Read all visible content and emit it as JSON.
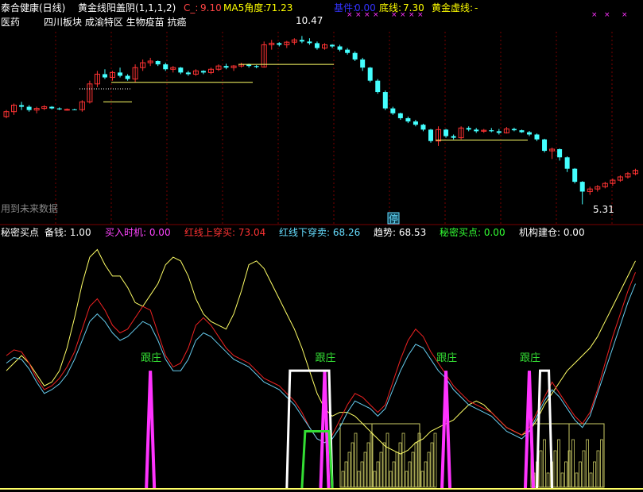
{
  "header": {
    "stock_name": "泰合健康(日线)",
    "indicator": "黄金线阳盖阴(1,1,1,2)",
    "c_label": "C_:",
    "c_value": "9.10",
    "ma5_label": "MA5角度:",
    "ma5_value": "71.23",
    "low_label": "底线:",
    "low_value": "7.30",
    "gold_label": "黄金虚线:",
    "gold_value": "-",
    "cut_label": "基件:",
    "cut_value": "0.00"
  },
  "tags": {
    "medicine": "医药",
    "concepts": "四川板块 成渝特区 生物疫苗 抗癌",
    "future": "用到未来数据",
    "stop": "停",
    "high_mark": "10.47",
    "low_mark": "5.31"
  },
  "indicator_header": {
    "name": "秘密买点",
    "items": [
      {
        "label": "备钱:",
        "value": "1.00",
        "color": "#ffffff"
      },
      {
        "label": "买入时机:",
        "value": "0.00",
        "color": "#ff44ff"
      },
      {
        "label": "红线上穿买:",
        "value": "73.04",
        "color": "#ff3333"
      },
      {
        "label": "红线下穿卖:",
        "value": "68.26",
        "color": "#66ddff"
      },
      {
        "label": "趋势:",
        "value": "68.53",
        "color": "#ffffff"
      },
      {
        "label": "秘密买点:",
        "value": "0.00",
        "color": "#33ff33"
      },
      {
        "label": "机构建仓:",
        "value": "0.00",
        "color": "#ffffff"
      }
    ],
    "follow_label": "跟庄"
  },
  "colors": {
    "up": "#ff3333",
    "down": "#44ffff",
    "yellow": "#ffff66",
    "magenta": "#ff33ff",
    "green": "#33dd33",
    "cyan_line": "#66ccee",
    "red_line": "#ee2222",
    "white": "#ffffff",
    "grid": "#7a0000"
  },
  "chart_data": {
    "type": "candlestick",
    "price": {
      "high_label": "10.47",
      "low_label": "5.31"
    },
    "candles": [
      [
        8.0,
        8.2,
        7.95,
        8.15
      ],
      [
        8.15,
        8.4,
        8.05,
        8.35
      ],
      [
        8.35,
        8.45,
        8.2,
        8.3
      ],
      [
        8.3,
        8.35,
        8.15,
        8.2
      ],
      [
        8.2,
        8.3,
        8.1,
        8.25
      ],
      [
        8.25,
        8.35,
        8.2,
        8.3
      ],
      [
        8.3,
        8.32,
        8.22,
        8.25
      ],
      [
        8.25,
        8.28,
        8.2,
        8.22
      ],
      [
        8.22,
        8.25,
        8.18,
        8.22
      ],
      [
        8.22,
        8.24,
        8.2,
        8.21
      ],
      [
        8.21,
        8.5,
        8.15,
        8.45
      ],
      [
        8.45,
        9.1,
        8.4,
        9.0
      ],
      [
        9.0,
        9.4,
        8.9,
        9.3
      ],
      [
        9.3,
        9.45,
        9.15,
        9.2
      ],
      [
        9.2,
        9.4,
        9.1,
        9.35
      ],
      [
        9.35,
        9.5,
        9.2,
        9.25
      ],
      [
        9.25,
        9.3,
        9.1,
        9.15
      ],
      [
        9.15,
        9.6,
        9.05,
        9.5
      ],
      [
        9.5,
        9.75,
        9.4,
        9.65
      ],
      [
        9.65,
        9.8,
        9.55,
        9.7
      ],
      [
        9.7,
        9.72,
        9.55,
        9.6
      ],
      [
        9.6,
        9.65,
        9.4,
        9.45
      ],
      [
        9.45,
        9.55,
        9.35,
        9.5
      ],
      [
        9.5,
        9.52,
        9.3,
        9.35
      ],
      [
        9.35,
        9.4,
        9.25,
        9.3
      ],
      [
        9.3,
        9.45,
        9.25,
        9.4
      ],
      [
        9.4,
        9.42,
        9.3,
        9.35
      ],
      [
        9.35,
        9.5,
        9.3,
        9.45
      ],
      [
        9.45,
        9.6,
        9.4,
        9.55
      ],
      [
        9.55,
        9.62,
        9.45,
        9.5
      ],
      [
        9.5,
        9.58,
        9.4,
        9.55
      ],
      [
        9.55,
        9.65,
        9.5,
        9.6
      ],
      [
        9.6,
        9.62,
        9.5,
        9.55
      ],
      [
        9.55,
        9.58,
        9.48,
        9.52
      ],
      [
        9.52,
        10.3,
        9.5,
        10.2
      ],
      [
        10.2,
        10.35,
        10.05,
        10.25
      ],
      [
        10.25,
        10.28,
        10.15,
        10.2
      ],
      [
        10.2,
        10.32,
        10.1,
        10.28
      ],
      [
        10.28,
        10.4,
        10.2,
        10.35
      ],
      [
        10.35,
        10.47,
        10.25,
        10.3
      ],
      [
        10.3,
        10.4,
        10.2,
        10.25
      ],
      [
        10.25,
        10.3,
        10.05,
        10.1
      ],
      [
        10.1,
        10.25,
        10.05,
        10.2
      ],
      [
        10.2,
        10.22,
        10.1,
        10.15
      ],
      [
        10.15,
        10.2,
        10.0,
        10.05
      ],
      [
        10.05,
        10.1,
        9.9,
        9.95
      ],
      [
        9.95,
        10.0,
        9.7,
        9.75
      ],
      [
        9.75,
        9.8,
        9.4,
        9.5
      ],
      [
        9.5,
        9.52,
        9.05,
        9.1
      ],
      [
        9.1,
        9.15,
        8.7,
        8.75
      ],
      [
        8.75,
        8.8,
        8.2,
        8.25
      ],
      [
        8.25,
        8.3,
        8.05,
        8.1
      ],
      [
        8.1,
        8.12,
        7.9,
        7.95
      ],
      [
        7.95,
        8.0,
        7.8,
        7.85
      ],
      [
        7.85,
        7.9,
        7.7,
        7.75
      ],
      [
        7.75,
        7.78,
        7.55,
        7.6
      ],
      [
        7.6,
        7.62,
        7.2,
        7.25
      ],
      [
        7.25,
        7.7,
        7.1,
        7.6
      ],
      [
        7.6,
        7.62,
        7.35,
        7.4
      ],
      [
        7.4,
        7.45,
        7.3,
        7.35
      ],
      [
        7.35,
        7.7,
        7.3,
        7.65
      ],
      [
        7.65,
        7.7,
        7.55,
        7.6
      ],
      [
        7.6,
        7.65,
        7.5,
        7.55
      ],
      [
        7.55,
        7.62,
        7.5,
        7.58
      ],
      [
        7.58,
        7.65,
        7.52,
        7.55
      ],
      [
        7.55,
        7.62,
        7.45,
        7.5
      ],
      [
        7.5,
        7.68,
        7.48,
        7.62
      ],
      [
        7.62,
        7.66,
        7.55,
        7.58
      ],
      [
        7.58,
        7.6,
        7.5,
        7.52
      ],
      [
        7.52,
        7.56,
        7.4,
        7.45
      ],
      [
        7.45,
        7.48,
        7.25,
        7.3
      ],
      [
        7.3,
        7.32,
        6.9,
        6.95
      ],
      [
        6.95,
        7.05,
        6.7,
        7.0
      ],
      [
        7.0,
        7.02,
        6.65,
        6.75
      ],
      [
        6.75,
        6.78,
        6.3,
        6.4
      ],
      [
        6.4,
        6.42,
        5.95,
        6.0
      ],
      [
        6.0,
        6.02,
        5.31,
        5.7
      ],
      [
        5.7,
        5.85,
        5.6,
        5.78
      ],
      [
        5.78,
        5.9,
        5.7,
        5.85
      ],
      [
        5.85,
        6.0,
        5.8,
        5.95
      ],
      [
        5.95,
        6.1,
        5.88,
        6.05
      ],
      [
        6.05,
        6.2,
        6.0,
        6.15
      ],
      [
        6.15,
        6.3,
        6.1,
        6.25
      ],
      [
        6.25,
        6.4,
        6.2,
        6.35
      ]
    ],
    "ind_white_yellow": [
      62,
      66,
      70,
      66,
      60,
      54,
      56,
      62,
      74,
      90,
      108,
      122,
      126,
      118,
      112,
      112,
      106,
      98,
      96,
      102,
      108,
      118,
      122,
      120,
      112,
      100,
      92,
      88,
      86,
      84,
      92,
      104,
      118,
      120,
      116,
      108,
      100,
      92,
      84,
      74,
      62,
      50,
      42,
      38,
      40,
      40,
      38,
      34,
      30,
      26,
      22,
      20,
      18,
      20,
      24,
      26,
      30,
      32,
      34,
      36,
      40,
      44,
      46,
      44,
      40,
      36,
      32,
      30,
      28,
      30,
      36,
      44,
      50,
      56,
      62,
      66,
      70,
      74,
      80,
      88,
      96,
      104,
      112,
      120
    ],
    "ind_red": [
      70,
      73,
      72,
      66,
      58,
      52,
      54,
      58,
      64,
      72,
      84,
      96,
      100,
      94,
      86,
      82,
      84,
      90,
      96,
      94,
      82,
      70,
      64,
      66,
      74,
      86,
      90,
      86,
      80,
      74,
      70,
      68,
      66,
      62,
      58,
      56,
      54,
      50,
      46,
      40,
      32,
      26,
      24,
      28,
      36,
      44,
      50,
      48,
      44,
      40,
      44,
      56,
      68,
      78,
      84,
      80,
      72,
      66,
      60,
      54,
      50,
      46,
      44,
      42,
      40,
      36,
      32,
      30,
      28,
      32,
      40,
      48,
      56,
      50,
      44,
      38,
      34,
      40,
      52,
      66,
      80,
      92,
      104,
      114
    ],
    "ind_cyan": [
      66,
      69,
      68,
      63,
      56,
      50,
      52,
      55,
      60,
      68,
      78,
      88,
      92,
      88,
      82,
      78,
      80,
      84,
      88,
      86,
      78,
      68,
      62,
      62,
      68,
      78,
      82,
      80,
      76,
      72,
      68,
      66,
      64,
      60,
      56,
      54,
      52,
      48,
      44,
      38,
      32,
      26,
      24,
      26,
      32,
      40,
      46,
      44,
      42,
      38,
      42,
      52,
      62,
      70,
      76,
      74,
      68,
      62,
      58,
      52,
      48,
      44,
      42,
      40,
      38,
      34,
      30,
      28,
      26,
      30,
      38,
      46,
      52,
      48,
      42,
      36,
      32,
      38,
      50,
      62,
      74,
      86,
      98,
      108
    ],
    "spikes_index": [
      19,
      42,
      58,
      69
    ],
    "white_hump": {
      "from": 37,
      "to": 43,
      "level": 62
    },
    "green_hump": {
      "from": 39,
      "to": 43,
      "level": 30
    },
    "white_hump2": {
      "from": 70,
      "to": 72,
      "level": 62
    }
  }
}
